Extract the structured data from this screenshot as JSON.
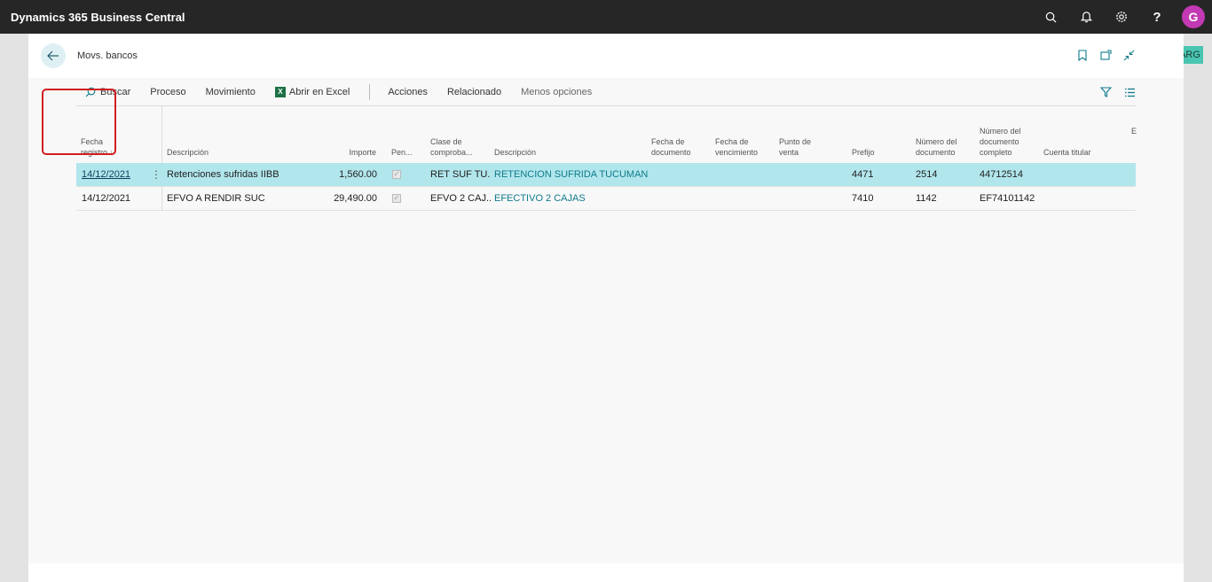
{
  "app": {
    "title": "Dynamics 365 Business Central",
    "user_initial": "G",
    "company_badge": "ARG"
  },
  "page": {
    "title": "Movs. bancos"
  },
  "actions": {
    "search": "Buscar",
    "process": "Proceso",
    "movement": "Movimiento",
    "excel": "Abrir en Excel",
    "actions": "Acciones",
    "related": "Relacionado",
    "fewer": "Menos opciones"
  },
  "columns": {
    "fecha": [
      "Fecha",
      "registro ↓"
    ],
    "descripcion": "Descripción",
    "importe": "Importe",
    "pend": "Pen...",
    "clase": [
      "Clase de",
      "comproba..."
    ],
    "descripcion2": "Descripción",
    "fecha_doc": [
      "Fecha de",
      "documento"
    ],
    "fecha_venc": [
      "Fecha de",
      "vencimiento"
    ],
    "punto": [
      "Punto de",
      "venta"
    ],
    "prefijo": "Prefijo",
    "numero_doc": [
      "Número del",
      "documento"
    ],
    "numero_completo": [
      "Número del",
      "documento",
      "completo"
    ],
    "cuenta": "Cuenta titular",
    "trunc": "E"
  },
  "rows": [
    {
      "fecha": "14/12/2021",
      "descripcion": "Retenciones sufridas IIBB",
      "importe": "1,560.00",
      "clase": "RET SUF TU...",
      "descripcion2": "RETENCION SUFRIDA TUCUMAN",
      "prefijo": "4471",
      "numero": "2514",
      "completo": "44712514"
    },
    {
      "fecha": "14/12/2021",
      "descripcion": "EFVO A RENDIR SUC",
      "importe": "29,490.00",
      "clase": "EFVO 2 CAJ...",
      "descripcion2": "EFECTIVO 2 CAJAS",
      "prefijo": "7410",
      "numero": "1142",
      "completo": "EF74101142"
    }
  ],
  "colors": {
    "accent": "#0f7b8a",
    "selected_row": "#b1e6ec",
    "highlight": "#d11f1f"
  }
}
